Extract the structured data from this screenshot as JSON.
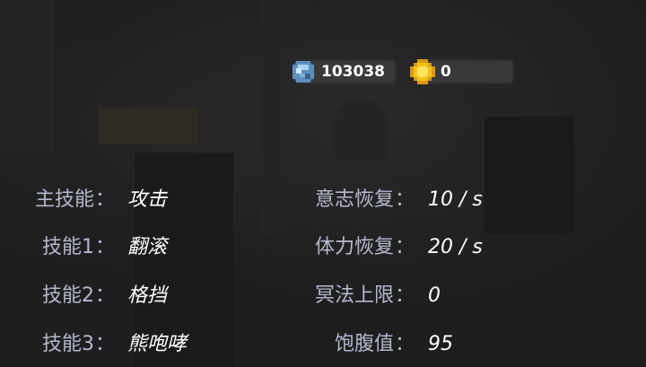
{
  "currency": {
    "gem_icon": "blue-gem-icon",
    "gem_amount": "103038",
    "coin_icon": "gold-coin-icon",
    "coin_amount": "0",
    "colors": {
      "gem": "#7fb0d6",
      "coin": "#f2c21b",
      "pill": "#3a393a"
    }
  },
  "skills": [
    {
      "label": "主技能",
      "value": "攻击"
    },
    {
      "label": "技能1",
      "value": "翻滚"
    },
    {
      "label": "技能2",
      "value": "格挡"
    },
    {
      "label": "技能3",
      "value": "熊咆哮"
    }
  ],
  "attributes": [
    {
      "label": "意志恢复",
      "value": "10 / s"
    },
    {
      "label": "体力恢复",
      "value": "20 / s"
    },
    {
      "label": "冥法上限",
      "value": "0"
    },
    {
      "label": "饱腹值",
      "value": "95"
    }
  ],
  "separator": "：",
  "colors": {
    "label": "#b5b8cf",
    "value": "#ffffff",
    "background": "#1f1e1f"
  }
}
